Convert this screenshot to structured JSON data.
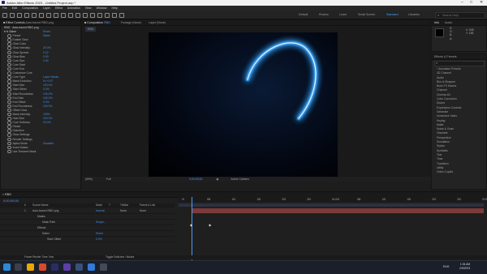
{
  "titlebar": {
    "title": "Adobe After Effects 2023 - Untitled Project.aep *"
  },
  "menu": [
    "File",
    "Edit",
    "Composition",
    "Layer",
    "Effect",
    "Animation",
    "View",
    "Window",
    "Help"
  ],
  "workspaces": [
    "Default",
    "Review",
    "Learn",
    "Small Screen",
    "Standard",
    "Libraries"
  ],
  "active_workspace": "Standard",
  "search": {
    "placeholder": "Search Help"
  },
  "effect_controls": {
    "tab": "Effect Controls",
    "layer_name": "Auto-traced RBG.png",
    "effect_name": "Saber",
    "reset_label": "Reset",
    "properties": [
      {
        "label": "Preset",
        "value": "Saber"
      },
      {
        "label": "Enable Glow",
        "value": ""
      },
      {
        "label": "Glow Color",
        "value": ""
      },
      {
        "label": "Glow Intensity",
        "value": "20.0%"
      },
      {
        "label": "Glow Spread",
        "value": "0.22"
      },
      {
        "label": "Glow Bias",
        "value": "0.50"
      },
      {
        "label": "Core Size",
        "value": "2.50"
      },
      {
        "label": "Core Start",
        "value": ""
      },
      {
        "label": "Core End",
        "value": ""
      },
      {
        "label": "Customize Core",
        "value": ""
      },
      {
        "label": "Core Type",
        "value": "Layer Masks"
      },
      {
        "label": "Mask Evolution",
        "value": "0x +0.0°"
      },
      {
        "label": "Start Size",
        "value": "100.0%"
      },
      {
        "label": "Start Offset",
        "value": "0.0%"
      },
      {
        "label": "Start Roundness",
        "value": "100.0%"
      },
      {
        "label": "End Size",
        "value": "100.0%"
      },
      {
        "label": "End Offset",
        "value": "0.0%"
      },
      {
        "label": "End Roundness",
        "value": "100.0%"
      },
      {
        "label": "Offset Glow",
        "value": ""
      },
      {
        "label": "Mask Intensity",
        "value": "100%"
      },
      {
        "label": "Halo Size",
        "value": "100.0%"
      },
      {
        "label": "Core Softness",
        "value": "20.0%"
      },
      {
        "label": "Flicker",
        "value": ""
      },
      {
        "label": "Distortion",
        "value": ""
      },
      {
        "label": "Glow Settings",
        "value": ""
      },
      {
        "label": "Render Settings",
        "value": ""
      },
      {
        "label": "Alpha Mode",
        "value": "Disabled"
      },
      {
        "label": "Invert Masks",
        "value": ""
      },
      {
        "label": "Use Textured Mask",
        "value": ""
      }
    ]
  },
  "composition": {
    "tab": "Composition",
    "comp_name": "RBG",
    "footage_label": "Footage (None)",
    "layer_label": "Layer (None)",
    "zoom": "(59%)",
    "quality": "Full",
    "timecode": "0;00;00;00",
    "active_camera": "Active Camera",
    "views": "1 View"
  },
  "info_panel": {
    "tabs": [
      "Info",
      "Audio"
    ],
    "values": [
      "R:",
      "G:",
      "B:",
      "A:",
      "X: 508",
      "Y: 188"
    ]
  },
  "effects_presets": {
    "tab": "Effects & Presets",
    "items": [
      "* Animation Presets",
      "3D Channel",
      "Audio",
      "Blur & Sharpen",
      "Boris FX Mocha",
      "Channel",
      "Cinema 4D",
      "Color Correction",
      "Distort",
      "Expression Controls",
      "Generate",
      "Immersive Video",
      "Keying",
      "Matte",
      "Noise & Grain",
      "Obsolete",
      "Perspective",
      "Simulation",
      "Stylize",
      "Synthetic",
      "Text",
      "Time",
      "Transition",
      "Utility",
      "Video Copilot"
    ]
  },
  "timeline": {
    "comp_tab": "RBG",
    "timecode": "0;00;00;00",
    "columns": [
      "#",
      "Source Name",
      "Mode",
      "T",
      "TrkMat",
      "Parent & Link"
    ],
    "layers": [
      {
        "num": "1",
        "name": "Auto-traced RBG.png",
        "mode": "Normal",
        "trkmat": "None",
        "parent": "None"
      },
      {
        "name": "Masks",
        "indent": 1
      },
      {
        "name": "Mask Path",
        "indent": 2,
        "mode": "Shape..."
      },
      {
        "name": "Effects",
        "indent": 1
      },
      {
        "name": "Saber",
        "indent": 2,
        "mode": "Reset"
      },
      {
        "name": "Start Offset",
        "indent": 3,
        "mode": "0.0%"
      }
    ],
    "ruler": [
      "0f",
      "05f",
      "10f",
      "15f",
      "20f",
      "25f",
      "01:00f",
      "05f",
      "10f",
      "15f",
      "20f",
      "25f",
      "02:00f"
    ],
    "footer": [
      "Frame Render Time: 0ms",
      "Toggle Switches / Modes"
    ]
  },
  "taskbar": {
    "time": "1:34 AM",
    "date": "2/9/2023",
    "lang": "ENG"
  },
  "colors": {
    "accent_blue": "#3d8ee8",
    "glow": "#4fb8ff",
    "ae_purple": "#9999ff"
  }
}
